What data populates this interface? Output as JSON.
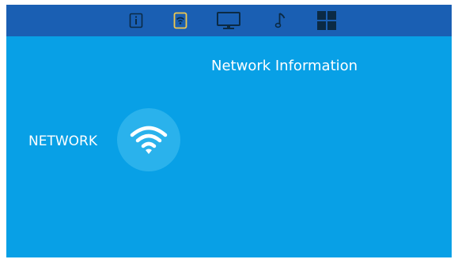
{
  "topbar": {
    "tabs": [
      {
        "icon": "info-icon"
      },
      {
        "icon": "network-icon"
      },
      {
        "icon": "display-icon"
      },
      {
        "icon": "music-icon"
      },
      {
        "icon": "apps-icon"
      }
    ]
  },
  "main": {
    "title": "Network Information",
    "section_label": "NETWORK",
    "section_icon": "wifi-icon"
  },
  "colors": {
    "background": "#08a0e6",
    "topbar": "#1a5fb3",
    "badge": "#2ab2ec",
    "text": "#ffffff",
    "icon_dark": "#0b2a44",
    "icon_accent": "#f2c94c"
  }
}
